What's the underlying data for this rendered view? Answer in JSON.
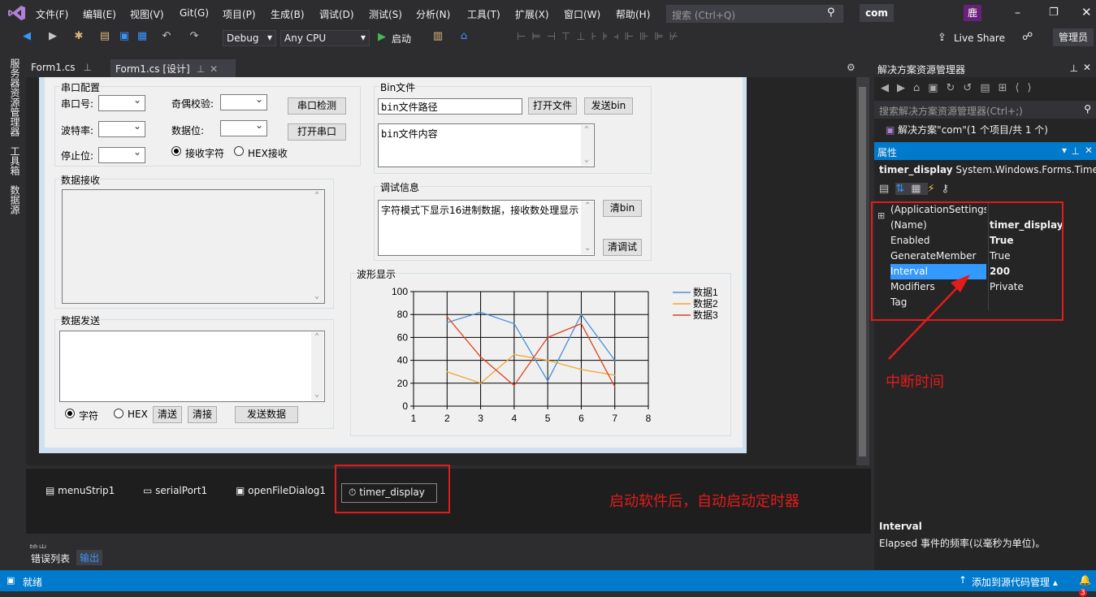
{
  "menu": {
    "items": [
      "文件(F)",
      "编辑(E)",
      "视图(V)",
      "Git(G)",
      "项目(P)",
      "生成(B)",
      "调试(D)",
      "测试(S)",
      "分析(N)",
      "工具(T)",
      "扩展(X)",
      "窗口(W)",
      "帮助(H)"
    ],
    "search_placeholder": "搜索 (Ctrl+Q)",
    "solution_name": "com",
    "user_initial": "鹿"
  },
  "toolbar": {
    "config": "Debug",
    "platform": "Any CPU",
    "start_label": "启动",
    "live_share": "Live Share",
    "admin": "管理员"
  },
  "left_tabs": [
    "服务器资源管理器",
    "工具箱",
    "数据源"
  ],
  "doc_tabs": [
    {
      "label": "Form1.cs"
    },
    {
      "label": "Form1.cs [设计]"
    }
  ],
  "form": {
    "serial_group": {
      "title": "串口配置",
      "port_label": "串口号:",
      "baud_label": "波特率:",
      "stop_label": "停止位:",
      "parity_label": "奇偶校验:",
      "data_label": "数据位:",
      "check_btn": "串口检测",
      "open_btn": "打开串口",
      "radio_char": "接收字符",
      "radio_hex": "HEX接收"
    },
    "bin_group": {
      "title": "Bin文件",
      "path_text": "bin文件路径",
      "open_btn": "打开文件",
      "send_btn": "发送bin",
      "content_text": "bin文件内容"
    },
    "recv_group": {
      "title": "数据接收"
    },
    "debug_group": {
      "title": "调试信息",
      "text": "字符模式下显示16进制数据，接收数处理显示",
      "clear_bin_btn": "清bin",
      "clear_debug_btn": "清调试"
    },
    "send_group": {
      "title": "数据发送",
      "radio_char": "字符",
      "radio_hex": "HEX",
      "clear_send_btn": "清送",
      "clear_recv_btn": "清接",
      "send_btn": "发送数据"
    },
    "wave_group": {
      "title": "波形显示"
    }
  },
  "chart_data": {
    "type": "line",
    "x": [
      1,
      2,
      3,
      4,
      5,
      6,
      7,
      8
    ],
    "xlim": [
      1,
      8
    ],
    "ylim": [
      0,
      100
    ],
    "xticks": [
      "1",
      "2",
      "3",
      "4",
      "5",
      "6",
      "7",
      "8"
    ],
    "yticks": [
      "0",
      "20",
      "40",
      "60",
      "80",
      "100"
    ],
    "grid": true,
    "legend_position": "top-right",
    "series": [
      {
        "name": "数据1",
        "color": "#4a90d9",
        "x": [
          2,
          3,
          4,
          5,
          6,
          7
        ],
        "values": [
          73,
          82,
          72,
          22,
          80,
          40
        ]
      },
      {
        "name": "数据2",
        "color": "#f0a830",
        "x": [
          2,
          3,
          4,
          5,
          6,
          7
        ],
        "values": [
          30,
          20,
          45,
          40,
          32,
          27
        ]
      },
      {
        "name": "数据3",
        "color": "#e04020",
        "x": [
          2,
          3,
          4,
          5,
          6,
          7
        ],
        "values": [
          78,
          43,
          18,
          60,
          72,
          17
        ]
      }
    ]
  },
  "tray": {
    "items": [
      "menuStrip1",
      "serialPort1",
      "openFileDialog1",
      "timer_display"
    ]
  },
  "output": {
    "title": "输出",
    "tabs": [
      "错误列表",
      "输出"
    ]
  },
  "solution_explorer": {
    "title": "解决方案资源管理器",
    "search_placeholder": "搜索解决方案资源管理器(Ctrl+;)",
    "solution_item": "解决方案\"com\"(1 个项目/共 1 个)"
  },
  "properties": {
    "title": "属性",
    "object_name": "timer_display",
    "object_type": "System.Windows.Forms.Timer",
    "rows": [
      {
        "key": "(ApplicationSettings",
        "value": ""
      },
      {
        "key": "(Name)",
        "value": "timer_display",
        "bold": true
      },
      {
        "key": "Enabled",
        "value": "True",
        "bold": true
      },
      {
        "key": "GenerateMember",
        "value": "True"
      },
      {
        "key": "Interval",
        "value": "200",
        "bold": true,
        "selected": true
      },
      {
        "key": "Modifiers",
        "value": "Private"
      },
      {
        "key": "Tag",
        "value": ""
      }
    ],
    "desc_title": "Interval",
    "desc_text": "Elapsed 事件的频率(以毫秒为单位)。"
  },
  "annotations": {
    "interval_note": "中断时间",
    "timer_note": "启动软件后，自动启动定时器"
  },
  "status": {
    "ready": "就绪",
    "source_control": "添加到源代码管理",
    "notifications": "3"
  },
  "colors": {
    "accent": "#007acc",
    "annotation": "#e31b1b",
    "vs_purple": "#68217a"
  }
}
